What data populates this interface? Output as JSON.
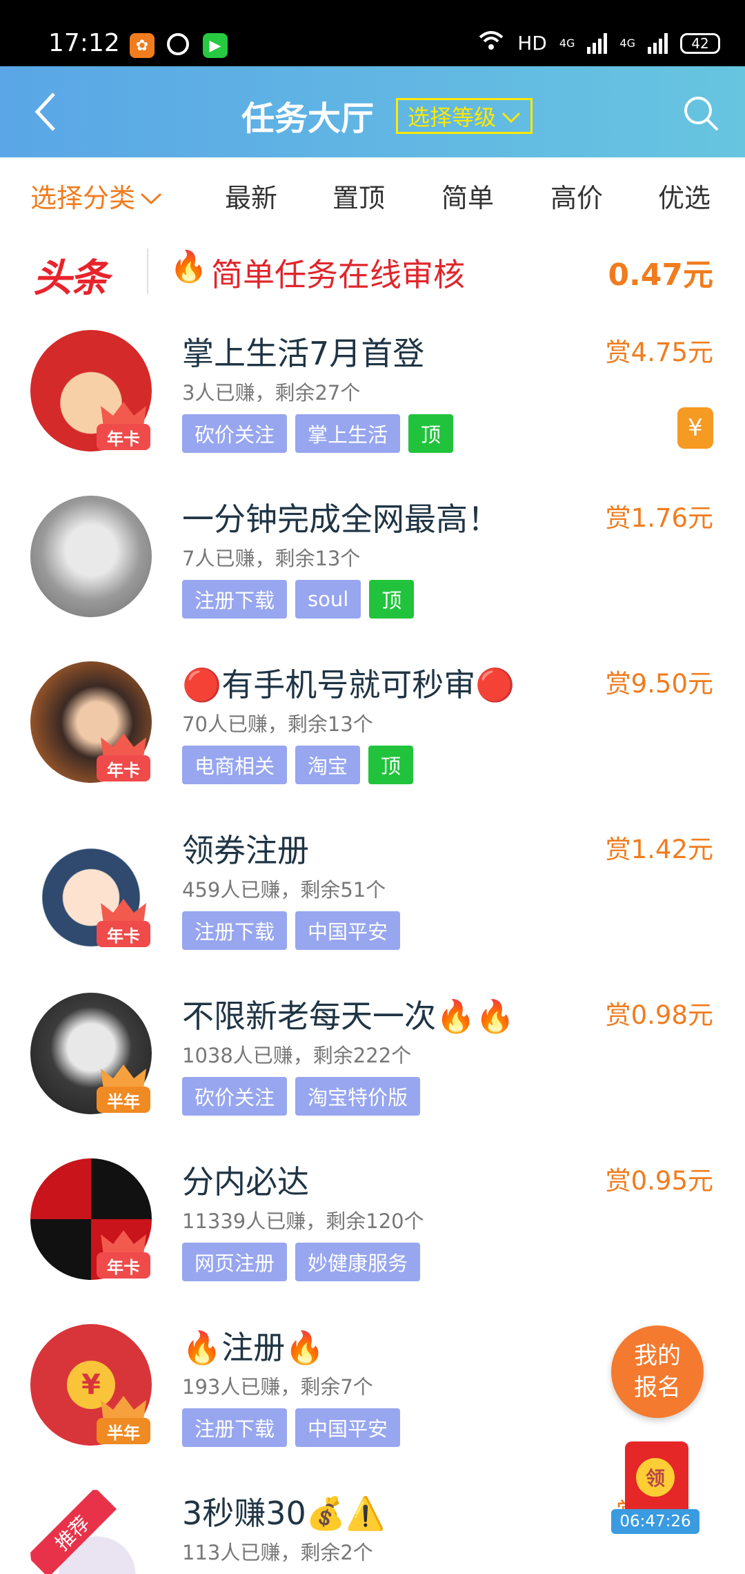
{
  "status_bar": {
    "time": "17:12",
    "network": "HD",
    "signal1": "4G",
    "signal2": "4G",
    "battery": "42"
  },
  "header": {
    "title": "任务大厅",
    "level_select": "选择等级"
  },
  "tabs": [
    {
      "label": "选择分类"
    },
    {
      "label": "最新"
    },
    {
      "label": "置顶"
    },
    {
      "label": "简单"
    },
    {
      "label": "高价"
    },
    {
      "label": "优选"
    }
  ],
  "headline": {
    "logo": "头条",
    "text": "简单任务在线审核",
    "reward": "0.47元"
  },
  "tasks": [
    {
      "title": "掌上生活7月首登",
      "meta": "3人已赚，剩余27个",
      "reward": "赏4.75元",
      "badge": "年卡",
      "tags": [
        "砍价关注",
        "掌上生活",
        "顶"
      ]
    },
    {
      "title": "一分钟完成全网最高！",
      "meta": "7人已赚，剩余13个",
      "reward": "赏1.76元",
      "badge": "",
      "tags": [
        "注册下载",
        "soul",
        "顶"
      ]
    },
    {
      "title": "🔴有手机号就可秒审🔴",
      "meta": "70人已赚，剩余13个",
      "reward": "赏9.50元",
      "badge": "年卡",
      "tags": [
        "电商相关",
        "淘宝",
        "顶"
      ]
    },
    {
      "title": "领券注册",
      "meta": "459人已赚，剩余51个",
      "reward": "赏1.42元",
      "badge": "年卡",
      "tags": [
        "注册下载",
        "中国平安"
      ]
    },
    {
      "title": "不限新老每天一次🔥🔥",
      "meta": "1038人已赚，剩余222个",
      "reward": "赏0.98元",
      "badge": "半年",
      "tags": [
        "砍价关注",
        "淘宝特价版"
      ]
    },
    {
      "title": "分内必达",
      "meta": "11339人已赚，剩余120个",
      "reward": "赏0.95元",
      "badge": "年卡",
      "tags": [
        "网页注册",
        "妙健康服务"
      ]
    },
    {
      "title": "🔥注册🔥",
      "meta": "193人已赚，剩余7个",
      "reward": "赏",
      "badge": "半年",
      "tags": [
        "注册下载",
        "中国平安"
      ]
    },
    {
      "title": "3秒赚30💰⚠️",
      "meta": "113人已赚，剩余2个",
      "reward": "赏",
      "badge": "",
      "tags": []
    }
  ],
  "floating": {
    "signup_line1": "我的",
    "signup_line2": "报名",
    "redpacket_coin": "领",
    "timer": "06:47:26"
  },
  "icons": {
    "yen": "¥",
    "recommend": "推荐"
  },
  "colors": {
    "accent": "#f07c1e",
    "tag": "#97a6ef",
    "tag_top": "#22c33c",
    "header_start": "#5aa6e6",
    "header_end": "#67c5e0"
  }
}
